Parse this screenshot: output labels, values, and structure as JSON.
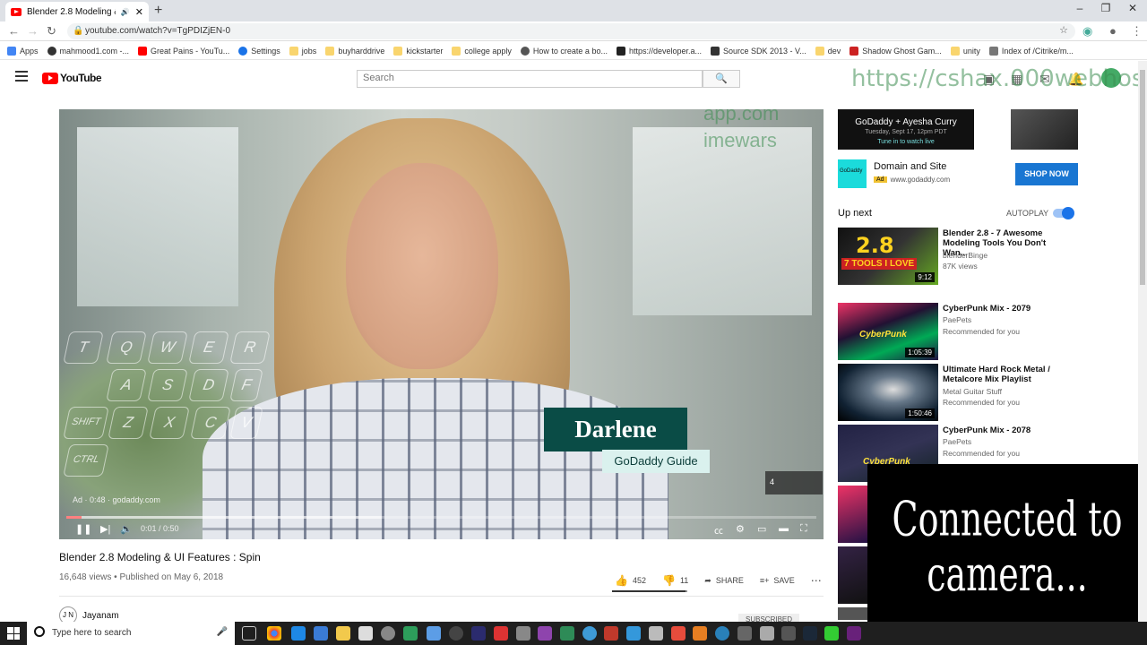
{
  "browser": {
    "tab_title": "Blender 2.8 Modeling & UI Fe...",
    "url": "youtube.com/watch?v=TgPDIZjEN-0",
    "bookmarks": [
      "Apps",
      "mahmood1.com -...",
      "Great Pains - YouTu...",
      "Settings",
      "jobs",
      "buyharddrive",
      "kickstarter",
      "college apply",
      "How to create a bo...",
      "https://developer.a...",
      "Source SDK 2013 - V...",
      "dev",
      "Shadow Ghost Gam...",
      "unity",
      "Index of /Citrike/m..."
    ]
  },
  "youtube": {
    "logo_text": "YouTube",
    "search_placeholder": "Search"
  },
  "video": {
    "title": "Blender 2.8 Modeling & UI Features : Spin",
    "views": "16,648 views",
    "published": "Published on May 6, 2018",
    "likes": "452",
    "dislikes": "11",
    "share_label": "SHARE",
    "save_label": "SAVE",
    "channel": "Jayanam",
    "channel_avatar": "J N",
    "subscribe_label": "SUBSCRIBED",
    "like_ratio": 0.976
  },
  "player": {
    "lower_third_name": "Darlene",
    "lower_third_role": "GoDaddy Guide",
    "ad_info": "Ad · 0:48 · godaddy.com",
    "timecode": "0:01 / 0:50",
    "skip_count": "4",
    "progress_fraction": 0.02,
    "buffer_fraction": 0.42,
    "keys": [
      "T",
      "Q",
      "W",
      "E",
      "R",
      "A",
      "S",
      "D",
      "F",
      "SHIFT",
      "Z",
      "X",
      "C",
      "V",
      "CTRL"
    ]
  },
  "ad": {
    "banner_line1": "GoDaddy + Ayesha Curry",
    "banner_line2": "Tuesday, Sept 17, 12pm PDT",
    "banner_line3": "Tune in to watch live",
    "logo_text": "GoDaddy",
    "title": "Domain and Site",
    "badge": "Ad",
    "site": "www.godaddy.com",
    "shop_label": "SHOP NOW"
  },
  "sidebar": {
    "up_next": "Up next",
    "autoplay": "AUTOPLAY",
    "items": [
      {
        "title": "Blender 2.8 - 7 Awesome Modeling Tools You Don't Wan...",
        "channel": "blenderBinge",
        "meta": "87K views",
        "duration": "9:12",
        "thumb_text": "2.8 7 TOOLS I LOVE"
      },
      {
        "title": "CyberPunk Mix - 2079",
        "channel": "PaePets",
        "meta": "Recommended for you",
        "duration": "1:05:39",
        "thumb_text": "CyberPunk Mix"
      },
      {
        "title": "Ultimate Hard Rock Metal / Metalcore Mix Playlist",
        "channel": "Metal Guitar Stuff",
        "meta": "Recommended for you",
        "duration": "1:50:46",
        "thumb_text": ""
      },
      {
        "title": "CyberPunk Mix - 2078",
        "channel": "PaePets",
        "meta": "Recommended for you",
        "duration": "",
        "thumb_text": "CyberPunk"
      }
    ]
  },
  "overlays": {
    "glitch_text": "Connected to camera...",
    "ghost_url1": "https://cshax.000webhos",
    "ghost_url2": "app.com",
    "ghost_url3": "imewars"
  },
  "taskbar": {
    "search_placeholder": "Type here to search"
  },
  "colors": {
    "youtube_red": "#ff0000",
    "godaddy_teal": "#0a4c46",
    "shop_blue": "#1976d2",
    "toggle_blue": "#1a73e8"
  }
}
